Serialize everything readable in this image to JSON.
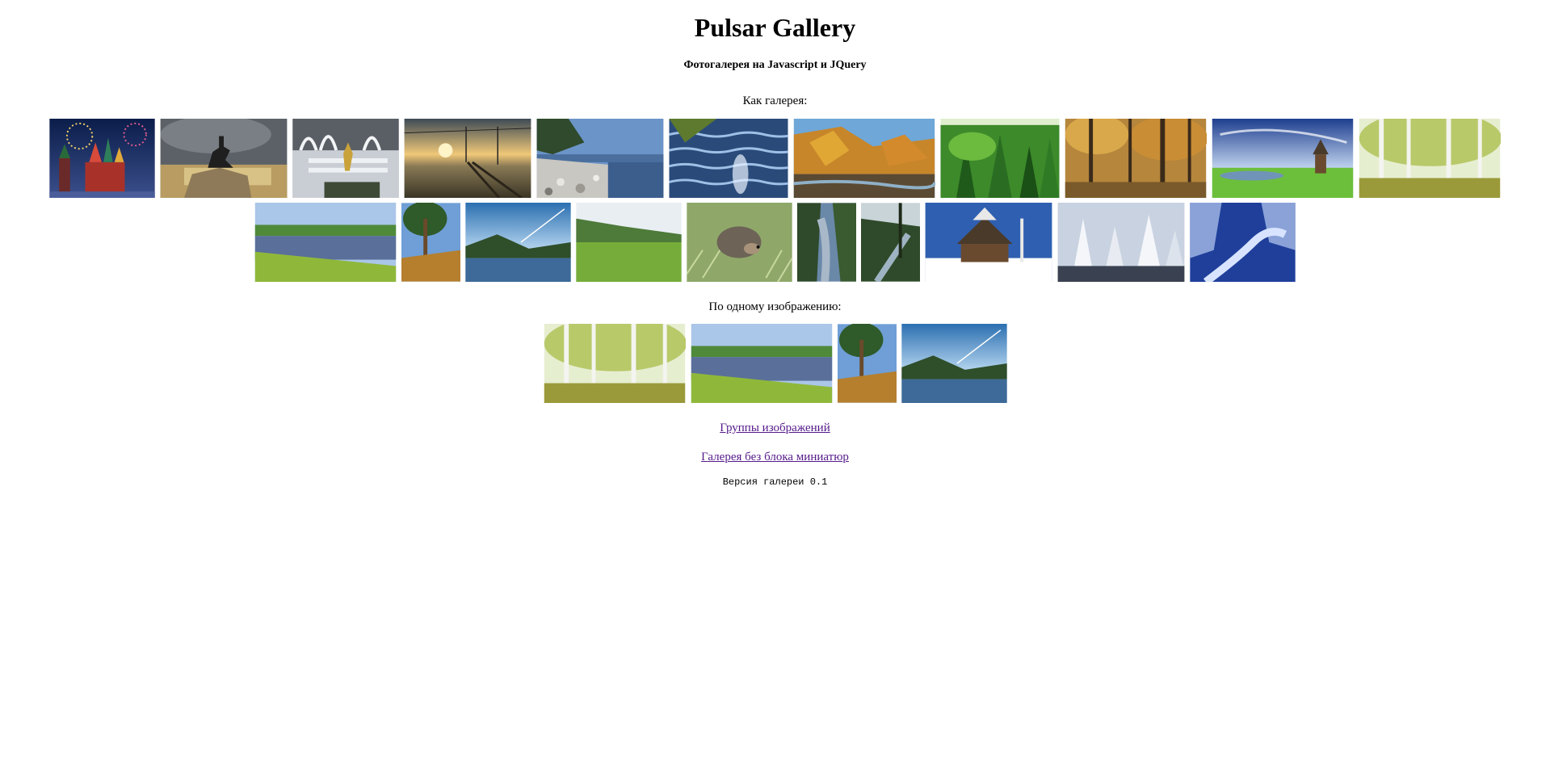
{
  "header": {
    "title": "Pulsar Gallery",
    "subtitle": "Фотогалерея на Javascript и JQuery"
  },
  "gallery": {
    "label": "Как галерея:",
    "rows": [
      [
        {
          "name": "moscow-fireworks-thumb"
        },
        {
          "name": "bronze-horseman-thumb"
        },
        {
          "name": "fountain-statue-thumb"
        },
        {
          "name": "railway-sunset-thumb"
        },
        {
          "name": "rocky-shore-thumb"
        },
        {
          "name": "water-ripples-thumb"
        },
        {
          "name": "autumn-river-thumb"
        },
        {
          "name": "green-forest-thumb"
        },
        {
          "name": "autumn-woods-thumb"
        },
        {
          "name": "wooden-church-thumb"
        },
        {
          "name": "birch-grove-thumb"
        }
      ],
      [
        {
          "name": "calm-river-thumb"
        },
        {
          "name": "pine-tree-thumb"
        },
        {
          "name": "lake-sky-thumb"
        },
        {
          "name": "green-meadow-thumb"
        },
        {
          "name": "hedgehog-thumb"
        },
        {
          "name": "river-gorge-thumb"
        },
        {
          "name": "forest-river-thumb"
        },
        {
          "name": "winter-church-thumb"
        },
        {
          "name": "snowy-trees-thumb"
        },
        {
          "name": "winter-stream-thumb"
        }
      ]
    ]
  },
  "single": {
    "label": "По одному изображению:",
    "items": [
      {
        "name": "birch-grove-thumb"
      },
      {
        "name": "calm-river-thumb"
      },
      {
        "name": "pine-tree-thumb"
      },
      {
        "name": "lake-sky-thumb"
      }
    ]
  },
  "links": {
    "groups": "Группы изображений",
    "no_thumbs": "Галерея без блока миниатюр"
  },
  "footer": {
    "version": "Версия галереи 0.1"
  }
}
